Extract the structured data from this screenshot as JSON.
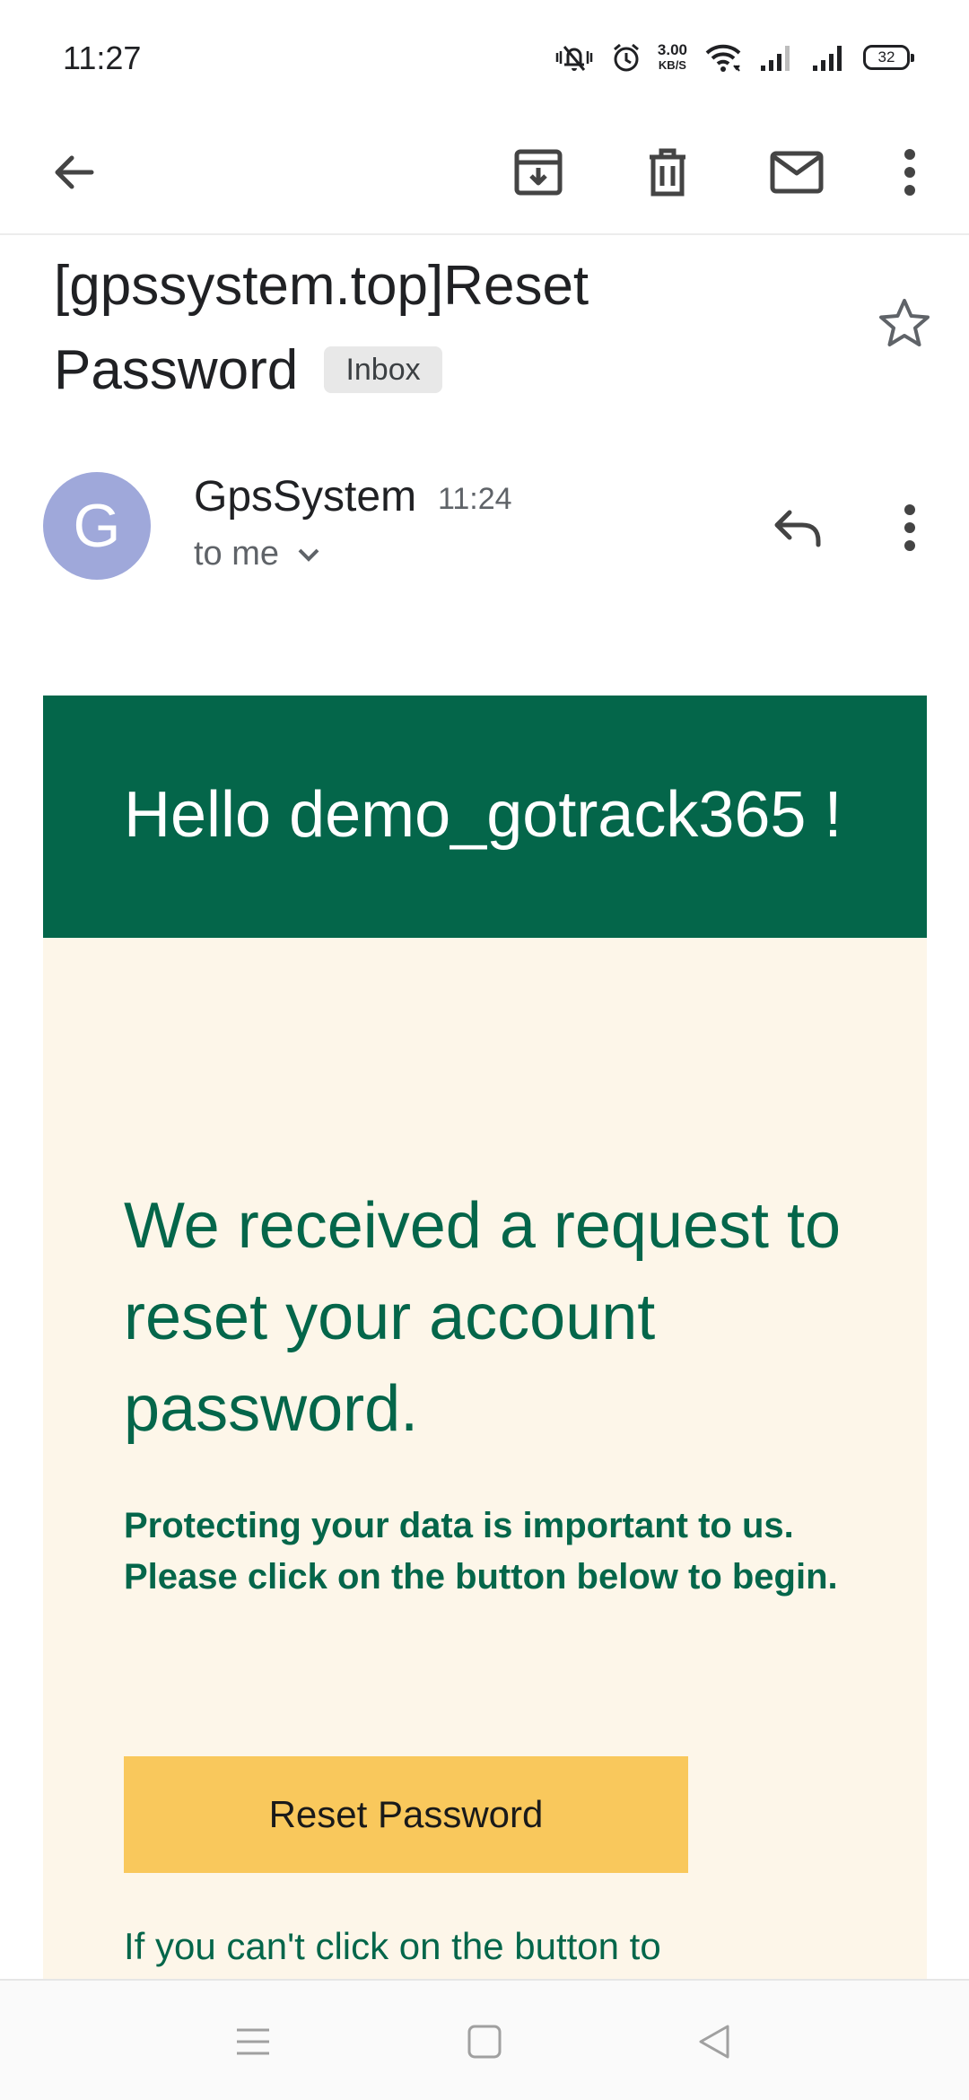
{
  "status_bar": {
    "time": "11:27",
    "net_speed": "3.00",
    "net_unit": "KB/S",
    "battery": "32",
    "icons": [
      "mute-vibrate-icon",
      "alarm-icon",
      "wifi-icon",
      "signal-icon",
      "signal-icon",
      "battery-icon"
    ]
  },
  "toolbar": {
    "icons": [
      "back-arrow-icon",
      "archive-icon",
      "delete-icon",
      "mark-unread-icon",
      "more-vert-icon"
    ]
  },
  "email": {
    "subject": "[gpssystem.top]Reset Password",
    "label": "Inbox",
    "sender_initial": "G",
    "sender_name": "GpsSystem",
    "time": "11:24",
    "recipient": "to me"
  },
  "body": {
    "greeting": "Hello demo_gotrack365 !",
    "headline": "We received a request to reset your account password.",
    "paragraph_line1": "Protecting your data is important to us.",
    "paragraph_line2": "Please click on the button below to begin.",
    "button_label": "Reset Password",
    "fallback_text": "If you can't click on the button to"
  },
  "colors": {
    "brand_green": "#04664a",
    "content_bg": "#fdf6e9",
    "button_yellow": "#f9c85c",
    "avatar": "#9fa8da"
  }
}
